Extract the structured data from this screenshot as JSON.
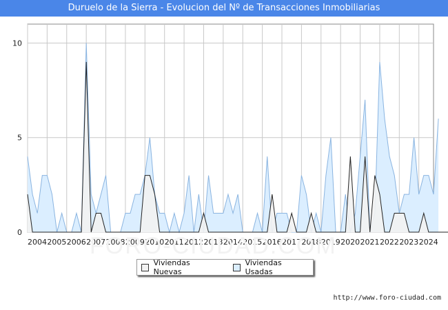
{
  "title": "Duruelo de la Sierra - Evolucion del Nº de Transacciones Inmobiliarias",
  "footer_url": "http://www.foro-ciudad.com",
  "watermark": "FORO-CIUDAD.COM",
  "colors": {
    "title_bg": "#4a86e8",
    "nuevas_fill": "#f2f2f2",
    "nuevas_line": "#222222",
    "usadas_fill": "#dbeeff",
    "usadas_line": "#8ab4e0"
  },
  "chart_data": {
    "type": "area",
    "title": "Duruelo de la Sierra - Evolucion del Nº de Transacciones Inmobiliarias",
    "x_start": 2004.0,
    "x_step": 0.25,
    "x_range": [
      2004,
      2024.75
    ],
    "ylim": [
      0,
      11
    ],
    "yticks": [
      "0",
      "5",
      "10"
    ],
    "xticks": [
      "2004",
      "2005",
      "2006",
      "2007",
      "2008",
      "2009",
      "2010",
      "2011",
      "2012",
      "2013",
      "2014",
      "2015",
      "2016",
      "2017",
      "2018",
      "2019",
      "2020",
      "2021",
      "2022",
      "2023",
      "2024"
    ],
    "grid": true,
    "legend_position": "bottom",
    "series": [
      {
        "name": "Viviendas Nuevas",
        "values": [
          2,
          0,
          0,
          0,
          0,
          0,
          0,
          0,
          0,
          0,
          0,
          0,
          9,
          0,
          1,
          1,
          0,
          0,
          0,
          0,
          0,
          0,
          0,
          0,
          3,
          3,
          2,
          0,
          0,
          0,
          0,
          0,
          0,
          0,
          0,
          0,
          1,
          0,
          0,
          0,
          0,
          0,
          0,
          0,
          0,
          0,
          0,
          0,
          0,
          0,
          2,
          0,
          0,
          0,
          1,
          0,
          0,
          0,
          1,
          0,
          0,
          0,
          0,
          0,
          0,
          0,
          4,
          0,
          0,
          4,
          0,
          3,
          2,
          0,
          0,
          1,
          1,
          1,
          0,
          0,
          0,
          1,
          0,
          0,
          0,
          0,
          0
        ]
      },
      {
        "name": "Viviendas Usadas",
        "values": [
          4,
          2,
          1,
          3,
          3,
          2,
          0,
          1,
          0,
          0,
          1,
          0,
          10,
          2,
          1,
          2,
          3,
          0,
          0,
          0,
          1,
          1,
          2,
          2,
          3,
          5,
          2,
          1,
          1,
          0,
          1,
          0,
          1,
          3,
          0,
          2,
          0,
          3,
          1,
          1,
          1,
          2,
          1,
          2,
          0,
          0,
          0,
          1,
          0,
          4,
          0,
          1,
          1,
          1,
          0,
          0,
          3,
          2,
          0,
          1,
          0,
          3,
          5,
          0,
          0,
          2,
          0,
          1,
          4,
          7,
          0,
          1,
          9,
          6,
          4,
          3,
          1,
          2,
          2,
          5,
          2,
          3,
          3,
          2,
          6
        ]
      }
    ]
  }
}
